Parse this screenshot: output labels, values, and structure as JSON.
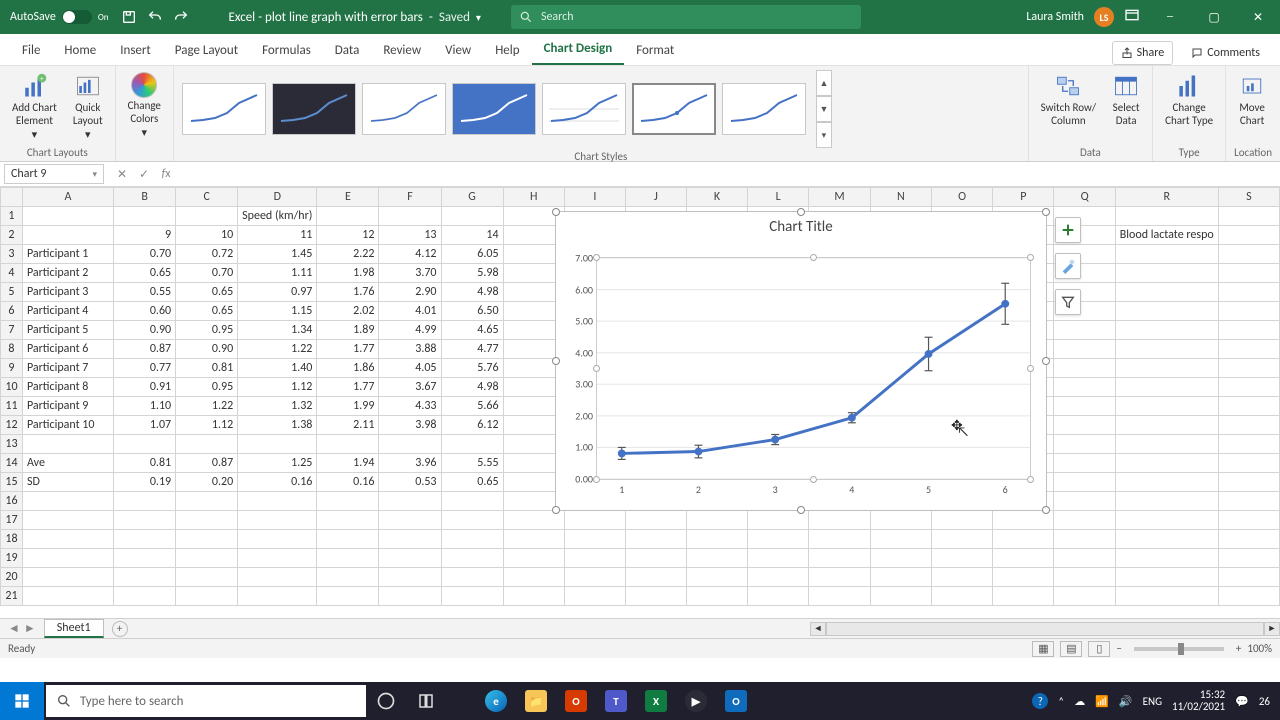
{
  "titlebar": {
    "autosave_label": "AutoSave",
    "autosave_state": "On",
    "doc_name": "Excel - plot line graph with error bars",
    "save_state": "Saved",
    "search_placeholder": "Search",
    "user_name": "Laura Smith",
    "user_initials": "LS"
  },
  "tabs": {
    "file": "File",
    "home": "Home",
    "insert": "Insert",
    "page_layout": "Page Layout",
    "formulas": "Formulas",
    "data": "Data",
    "review": "Review",
    "view": "View",
    "help": "Help",
    "chart_design": "Chart Design",
    "format": "Format",
    "share": "Share",
    "comments": "Comments"
  },
  "ribbon": {
    "add_chart_element": "Add Chart\nElement",
    "quick_layout": "Quick\nLayout",
    "change_colors": "Change\nColors",
    "switch_row_col": "Switch Row/\nColumn",
    "select_data": "Select\nData",
    "change_chart_type": "Change\nChart Type",
    "move_chart": "Move\nChart",
    "groups": {
      "chart_layouts": "Chart Layouts",
      "chart_styles": "Chart Styles",
      "data": "Data",
      "type": "Type",
      "location": "Location"
    }
  },
  "namebox": "Chart 9",
  "sheet_name": "Sheet1",
  "statusbar": {
    "ready": "Ready",
    "zoom": "100%"
  },
  "taskbar": {
    "search_placeholder": "Type here to search",
    "time": "15:32",
    "date": "11/02/2021",
    "temp": "26"
  },
  "sheet": {
    "corner_text": "",
    "header_label": "Speed (km/hr)",
    "cut_text": "Blood lactate respo",
    "columns": [
      "A",
      "B",
      "C",
      "D",
      "E",
      "F",
      "G",
      "H",
      "I",
      "J",
      "K",
      "L",
      "M",
      "N",
      "O",
      "P",
      "Q",
      "R",
      "S"
    ],
    "row_numbers": [
      1,
      2,
      3,
      4,
      5,
      6,
      7,
      8,
      9,
      10,
      11,
      12,
      13,
      14,
      15,
      16,
      17,
      18,
      19,
      20,
      21
    ],
    "speeds": [
      9,
      10,
      11,
      12,
      13,
      14
    ],
    "participants": [
      {
        "name": "Participant 1",
        "vals": [
          0.7,
          0.72,
          1.45,
          2.22,
          4.12,
          6.05
        ]
      },
      {
        "name": "Participant 2",
        "vals": [
          0.65,
          0.7,
          1.11,
          1.98,
          3.7,
          5.98
        ]
      },
      {
        "name": "Participant 3",
        "vals": [
          0.55,
          0.65,
          0.97,
          1.76,
          2.9,
          4.98
        ]
      },
      {
        "name": "Participant 4",
        "vals": [
          0.6,
          0.65,
          1.15,
          2.02,
          4.01,
          6.5
        ]
      },
      {
        "name": "Participant 5",
        "vals": [
          0.9,
          0.95,
          1.34,
          1.89,
          4.99,
          4.65
        ]
      },
      {
        "name": "Participant 6",
        "vals": [
          0.87,
          0.9,
          1.22,
          1.77,
          3.88,
          4.77
        ]
      },
      {
        "name": "Participant 7",
        "vals": [
          0.77,
          0.81,
          1.4,
          1.86,
          4.05,
          5.76
        ]
      },
      {
        "name": "Participant 8",
        "vals": [
          0.91,
          0.95,
          1.12,
          1.77,
          3.67,
          4.98
        ]
      },
      {
        "name": "Participant 9",
        "vals": [
          1.1,
          1.22,
          1.32,
          1.99,
          4.33,
          5.66
        ]
      },
      {
        "name": "Participant 10",
        "vals": [
          1.07,
          1.12,
          1.38,
          2.11,
          3.98,
          6.12
        ]
      }
    ],
    "ave": {
      "name": "Ave",
      "vals": [
        0.81,
        0.87,
        1.25,
        1.94,
        3.96,
        5.55
      ]
    },
    "sd": {
      "name": "SD",
      "vals": [
        0.19,
        0.2,
        0.16,
        0.16,
        0.53,
        0.65
      ]
    }
  },
  "chart_data": {
    "type": "line",
    "title": "Chart Title",
    "xlabel": "",
    "ylabel": "",
    "x": [
      1,
      2,
      3,
      4,
      5,
      6
    ],
    "ylim": [
      0,
      7
    ],
    "y_ticks": [
      0.0,
      1.0,
      2.0,
      3.0,
      4.0,
      5.0,
      6.0,
      7.0
    ],
    "series": [
      {
        "name": "Ave",
        "values": [
          0.81,
          0.87,
          1.25,
          1.94,
          3.96,
          5.55
        ],
        "errors": [
          0.19,
          0.2,
          0.16,
          0.16,
          0.53,
          0.65
        ]
      }
    ],
    "accent_color": "#4472c4"
  }
}
